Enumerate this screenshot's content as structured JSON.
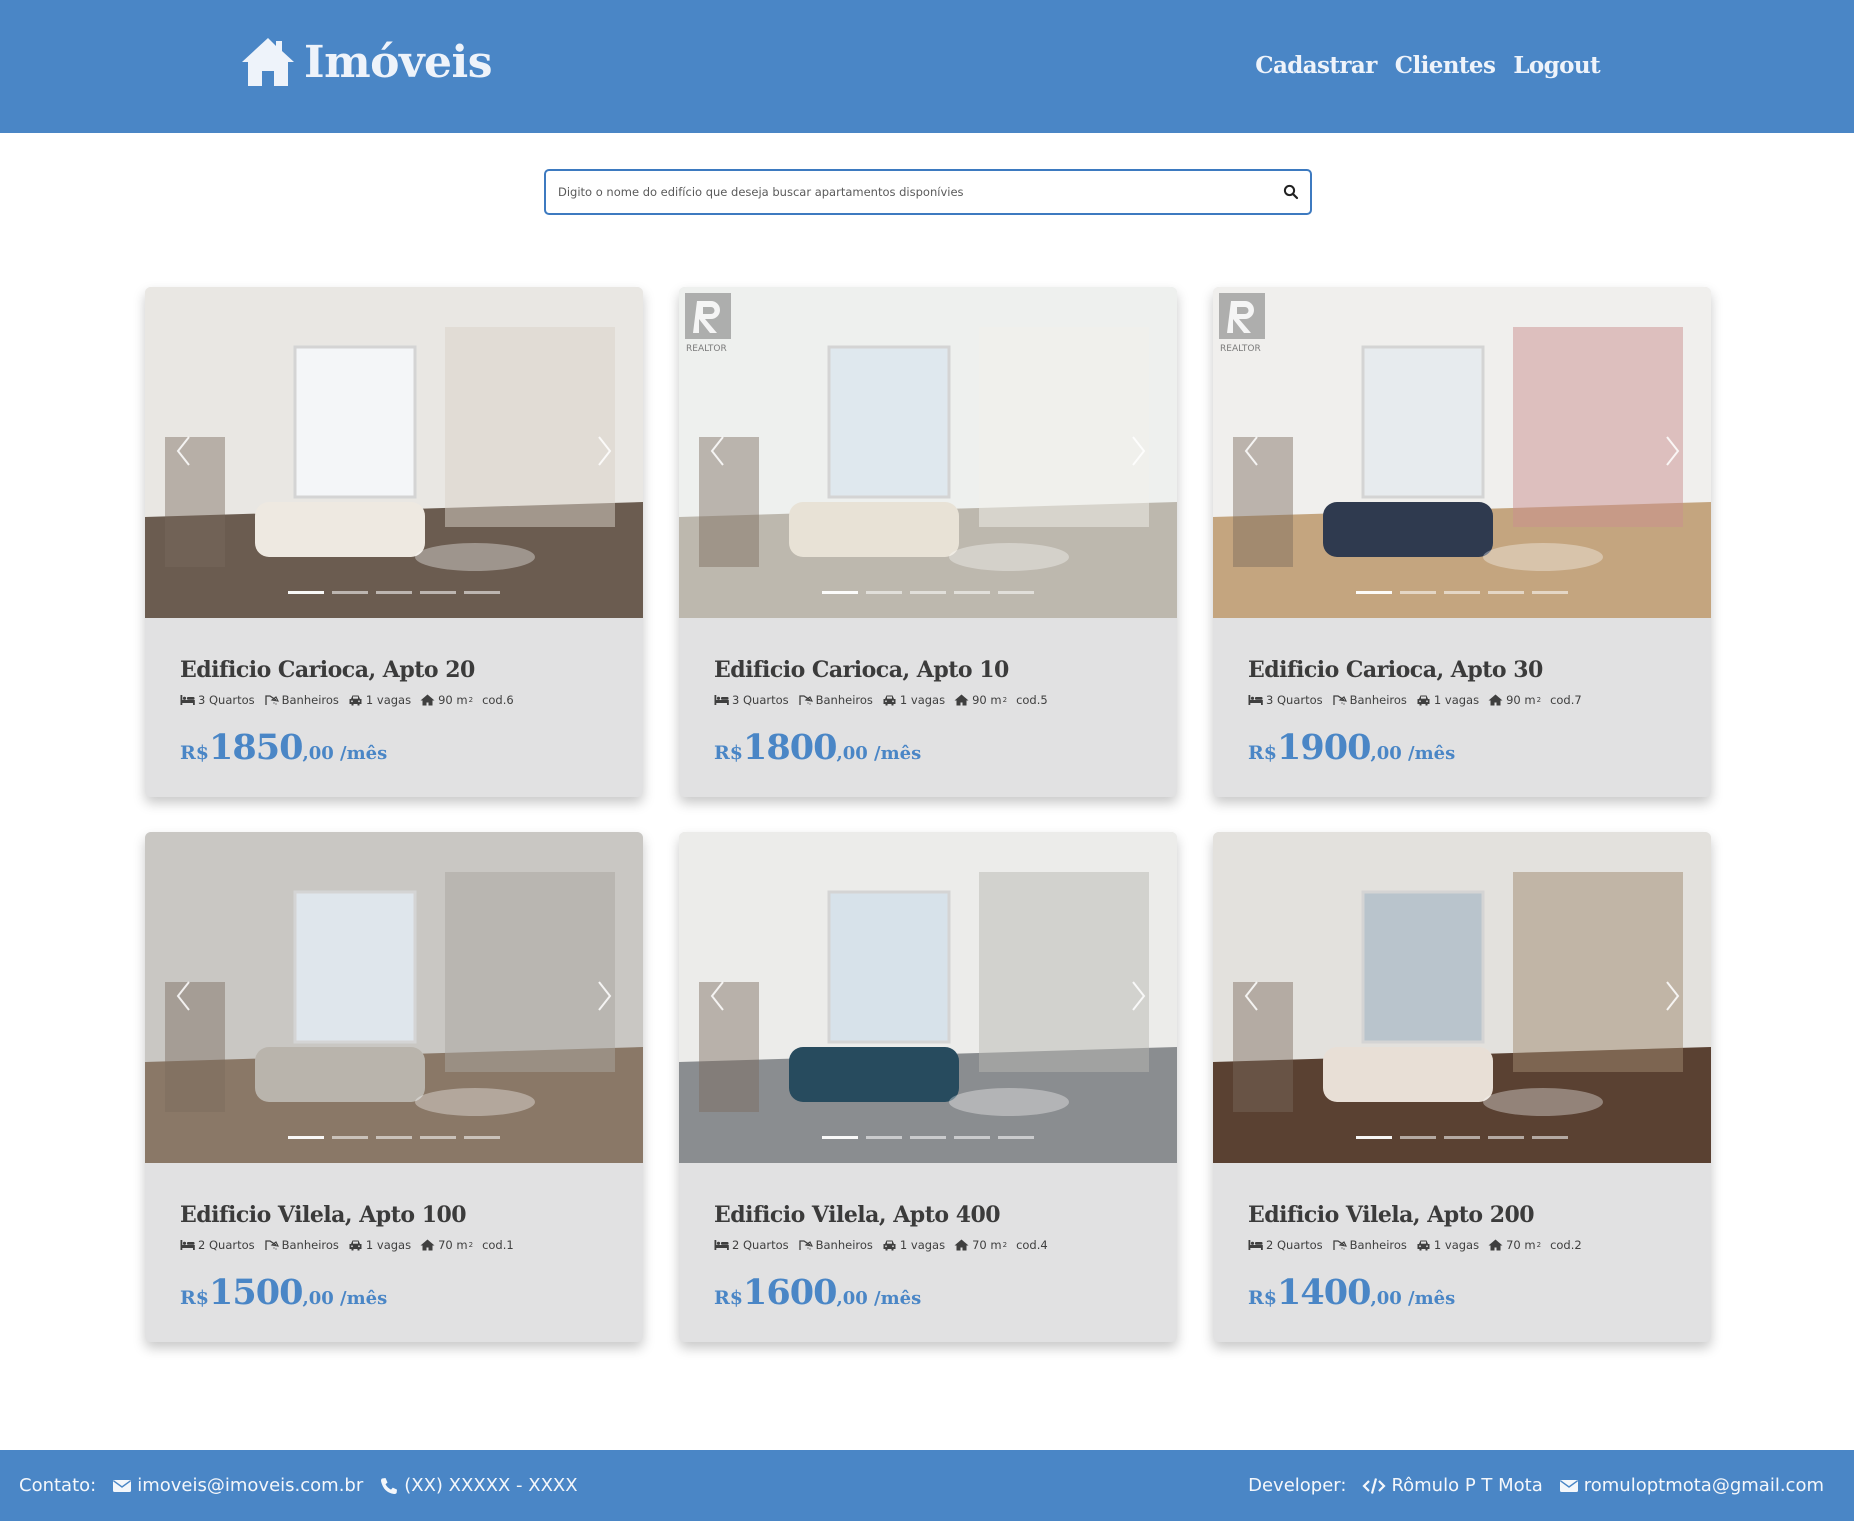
{
  "brand": {
    "name": "Imóveis",
    "icon": "house-icon"
  },
  "nav": [
    {
      "label": "Cadastrar"
    },
    {
      "label": "Clientes"
    },
    {
      "label": "Logout"
    }
  ],
  "search": {
    "placeholder": "Digito o nome do edifício que deseja buscar apartamentos disponívies",
    "value": ""
  },
  "colors": {
    "primary": "#4a86c6",
    "card_bg": "#e1e1e2",
    "text": "#3b3b3b"
  },
  "listings": [
    {
      "title": "Edificio Carioca, Apto 20",
      "quartos": "3 Quartos",
      "banheiros": "Banheiros",
      "vagas": "1 vagas",
      "area": "90 m",
      "area_sup": "2",
      "cod": "cod.6",
      "currency": "R$",
      "price_int": "1850",
      "price_suffix": ",00 /mês",
      "watermark": ""
    },
    {
      "title": "Edificio Carioca, Apto 10",
      "quartos": "3 Quartos",
      "banheiros": "Banheiros",
      "vagas": "1 vagas",
      "area": "90 m",
      "area_sup": "2",
      "cod": "cod.5",
      "currency": "R$",
      "price_int": "1800",
      "price_suffix": ",00 /mês",
      "watermark": "REALTOR"
    },
    {
      "title": "Edificio Carioca, Apto 30",
      "quartos": "3 Quartos",
      "banheiros": "Banheiros",
      "vagas": "1 vagas",
      "area": "90 m",
      "area_sup": "2",
      "cod": "cod.7",
      "currency": "R$",
      "price_int": "1900",
      "price_suffix": ",00 /mês",
      "watermark": "REALTOR"
    },
    {
      "title": "Edificio Vilela, Apto 100",
      "quartos": "2 Quartos",
      "banheiros": "Banheiros",
      "vagas": "1 vagas",
      "area": "70 m",
      "area_sup": "2",
      "cod": "cod.1",
      "currency": "R$",
      "price_int": "1500",
      "price_suffix": ",00 /mês",
      "watermark": ""
    },
    {
      "title": "Edificio Vilela, Apto 400",
      "quartos": "2 Quartos",
      "banheiros": "Banheiros",
      "vagas": "1 vagas",
      "area": "70 m",
      "area_sup": "2",
      "cod": "cod.4",
      "currency": "R$",
      "price_int": "1600",
      "price_suffix": ",00 /mês",
      "watermark": ""
    },
    {
      "title": "Edificio Vilela, Apto 200",
      "quartos": "2 Quartos",
      "banheiros": "Banheiros",
      "vagas": "1 vagas",
      "area": "70 m",
      "area_sup": "2",
      "cod": "cod.2",
      "currency": "R$",
      "price_int": "1400",
      "price_suffix": ",00 /mês",
      "watermark": ""
    }
  ],
  "footer": {
    "contact_label": "Contato:",
    "email": "imoveis@imoveis.com.br",
    "phone": "(XX) XXXXX - XXXX",
    "developer_label": "Developer:",
    "developer_name": "Rômulo P T Mota",
    "developer_email": "romuloptmota@gmail.com"
  }
}
